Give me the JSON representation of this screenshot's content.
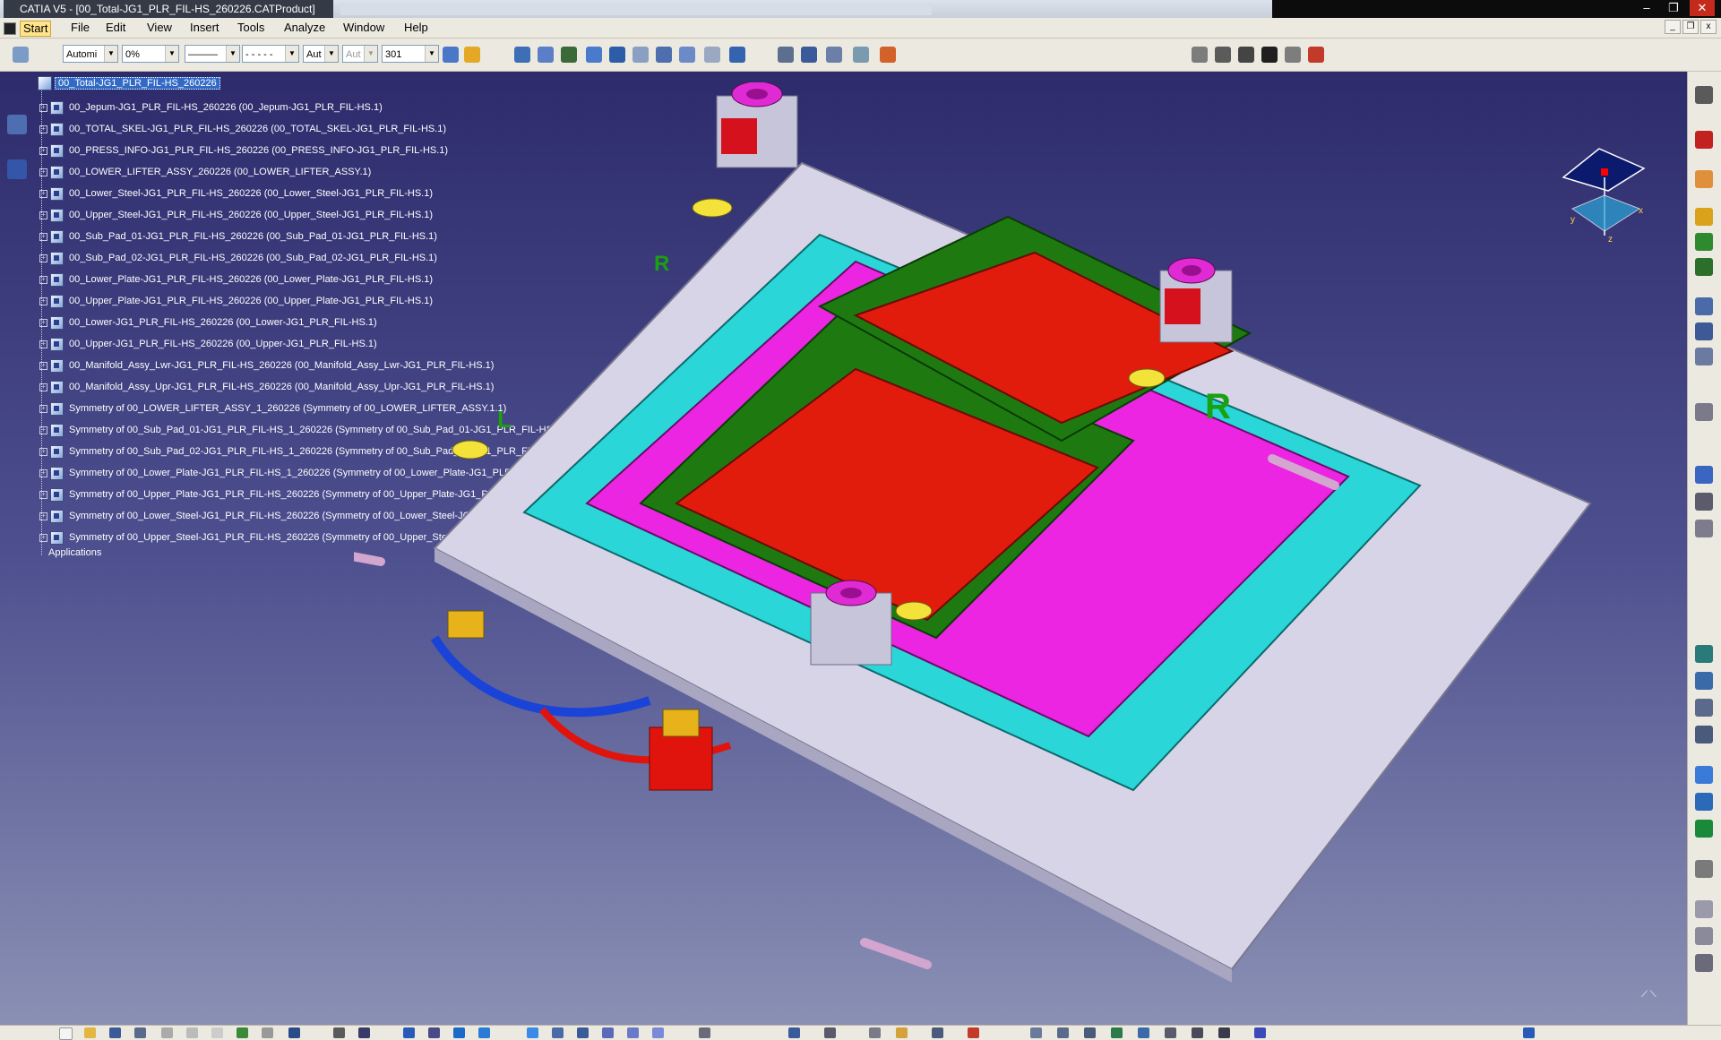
{
  "window": {
    "title": "CATIA V5 - [00_Total-JG1_PLR_FIL-HS_260226.CATProduct]",
    "controls": {
      "minimize": "‒",
      "maximize": "❐",
      "close": "✕"
    }
  },
  "menu": {
    "items": [
      "Start",
      "File",
      "Edit",
      "View",
      "Insert",
      "Tools",
      "Analyze",
      "Window",
      "Help"
    ]
  },
  "toolbar": {
    "color_combo": "Automi",
    "transparency_combo": "0%",
    "linetype_combo": "———",
    "thickness_combo": "- - - - -",
    "point_combo": "Aut",
    "layer_combo_disabled": "Aut",
    "layer_combo": "301"
  },
  "tree": {
    "root": "00_Total-JG1_PLR_FIL-HS_260226",
    "nodes": [
      "00_Jepum-JG1_PLR_FIL-HS_260226 (00_Jepum-JG1_PLR_FIL-HS.1)",
      "00_TOTAL_SKEL-JG1_PLR_FIL-HS_260226 (00_TOTAL_SKEL-JG1_PLR_FIL-HS.1)",
      "00_PRESS_INFO-JG1_PLR_FIL-HS_260226 (00_PRESS_INFO-JG1_PLR_FIL-HS.1)",
      "00_LOWER_LIFTER_ASSY_260226 (00_LOWER_LIFTER_ASSY.1)",
      "00_Lower_Steel-JG1_PLR_FIL-HS_260226 (00_Lower_Steel-JG1_PLR_FIL-HS.1)",
      "00_Upper_Steel-JG1_PLR_FIL-HS_260226 (00_Upper_Steel-JG1_PLR_FIL-HS.1)",
      "00_Sub_Pad_01-JG1_PLR_FIL-HS_260226 (00_Sub_Pad_01-JG1_PLR_FIL-HS.1)",
      "00_Sub_Pad_02-JG1_PLR_FIL-HS_260226 (00_Sub_Pad_02-JG1_PLR_FIL-HS.1)",
      "00_Lower_Plate-JG1_PLR_FIL-HS_260226 (00_Lower_Plate-JG1_PLR_FIL-HS.1)",
      "00_Upper_Plate-JG1_PLR_FIL-HS_260226 (00_Upper_Plate-JG1_PLR_FIL-HS.1)",
      "00_Lower-JG1_PLR_FIL-HS_260226 (00_Lower-JG1_PLR_FIL-HS.1)",
      "00_Upper-JG1_PLR_FIL-HS_260226 (00_Upper-JG1_PLR_FIL-HS.1)",
      "00_Manifold_Assy_Lwr-JG1_PLR_FIL-HS_260226 (00_Manifold_Assy_Lwr-JG1_PLR_FIL-HS.1)",
      "00_Manifold_Assy_Upr-JG1_PLR_FIL-HS_260226 (00_Manifold_Assy_Upr-JG1_PLR_FIL-HS.1)",
      "Symmetry of 00_LOWER_LIFTER_ASSY_1_260226 (Symmetry of 00_LOWER_LIFTER_ASSY.1.1)",
      "Symmetry of 00_Sub_Pad_01-JG1_PLR_FIL-HS_1_260226 (Symmetry of 00_Sub_Pad_01-JG1_PLR_FIL-HS.1.1)",
      "Symmetry of 00_Sub_Pad_02-JG1_PLR_FIL-HS_1_260226 (Symmetry of 00_Sub_Pad_02-JG1_PLR_FIL-HS.1.1)",
      "Symmetry of 00_Lower_Plate-JG1_PLR_FIL-HS_1_260226 (Symmetry of 00_Lower_Plate-JG1_PLR_FIL-HS.1.1)",
      "Symmetry of 00_Upper_Plate-JG1_PLR_FIL-HS_260226 (Symmetry of 00_Upper_Plate-JG1_PLR_FIL-HS.1.1)",
      "Symmetry of 00_Lower_Steel-JG1_PLR_FIL-HS_260226 (Symmetry of 00_Lower_Steel-JG1_PLR_FIL-HS.1.1)",
      "Symmetry of 00_Upper_Steel-JG1_PLR_FIL-HS_260226 (Symmetry of 00_Upper_Steel-JG1_PLR_FIL-HS.1.1)"
    ],
    "applications": "Applications"
  },
  "model": {
    "marker_left": "L",
    "marker_right": "R",
    "marker_top": "R",
    "colors": {
      "frame": "#d6d4e6",
      "panel": "#e11c0c",
      "base": "#1e7a10",
      "pad": "#ec25e2",
      "block": "#2ad6d8",
      "ring": "#e02ad4"
    }
  },
  "compass": {
    "x": "x",
    "y": "y",
    "z": "z"
  }
}
